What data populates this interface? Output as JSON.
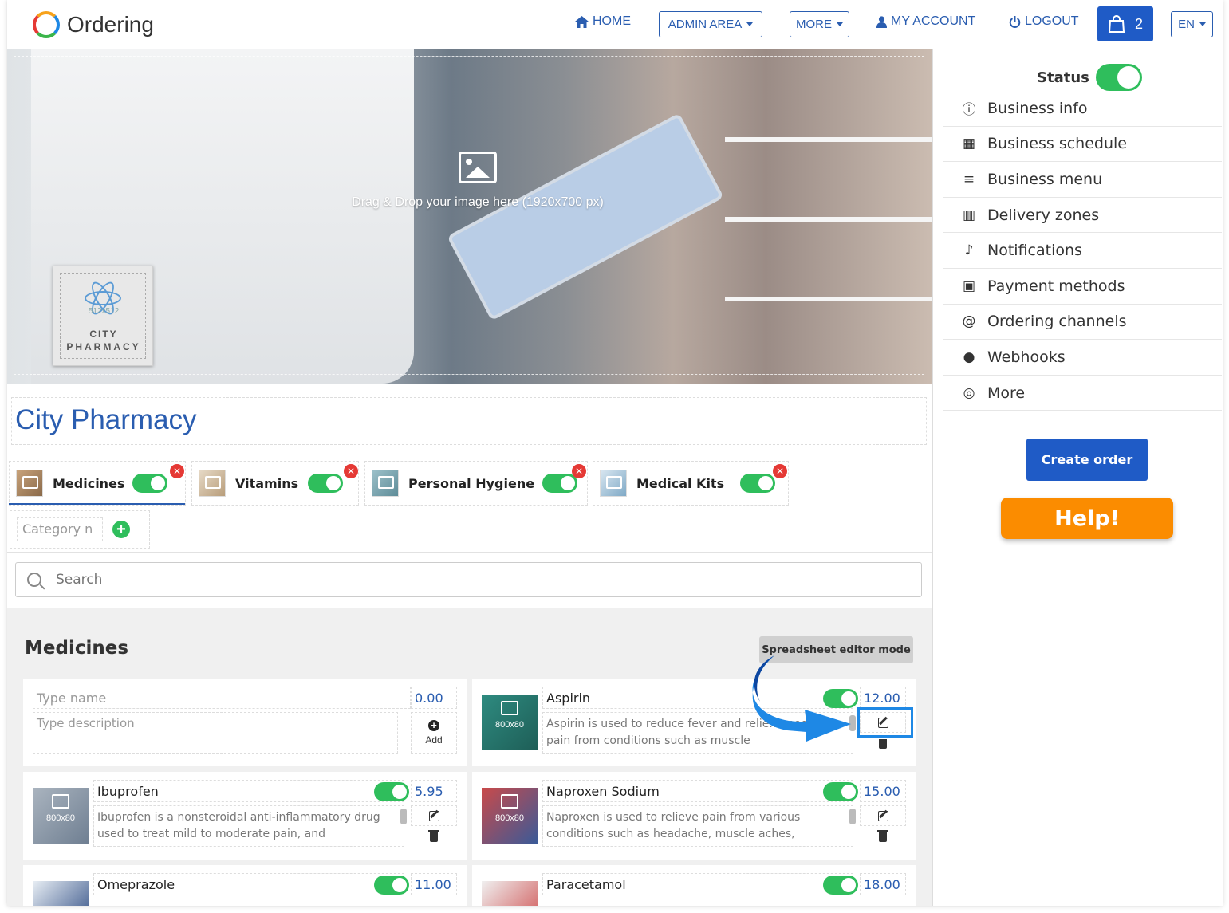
{
  "app": {
    "name": "Ordering"
  },
  "nav": {
    "home": "HOME",
    "admin_area": "ADMIN AREA",
    "more": "MORE",
    "my_account": "MY ACCOUNT",
    "logout": "LOGOUT",
    "cart_count": "2",
    "language": "EN"
  },
  "banner": {
    "drop_text": "Drag & Drop your image here (1920x700 px)",
    "logo_size": "512x512",
    "logo_line1": "CITY",
    "logo_line2": "PHARMACY"
  },
  "business": {
    "name": "City Pharmacy"
  },
  "categories": [
    {
      "name": "Medicines",
      "enabled": true,
      "active": true
    },
    {
      "name": "Vitamins",
      "enabled": true
    },
    {
      "name": "Personal Hygiene",
      "enabled": true
    },
    {
      "name": "Medical Kits",
      "enabled": true
    }
  ],
  "new_category": {
    "placeholder": "Category n"
  },
  "search": {
    "placeholder": "Search"
  },
  "section": {
    "title": "Medicines",
    "spreadsheet_button": "Spreadsheet editor mode"
  },
  "new_product": {
    "name_placeholder": "Type name",
    "description_placeholder": "Type description",
    "price": "0.00",
    "add_label": "Add"
  },
  "products": [
    {
      "name": "Aspirin",
      "price": "12.00",
      "description": "Aspirin is used to reduce fever and relie... moderate pain from conditions such as muscle",
      "image_size": "800x80",
      "enabled": true
    },
    {
      "name": "Ibuprofen",
      "price": "5.95",
      "description": "Ibuprofen is a nonsteroidal anti-inflammatory drug used to treat mild to moderate pain, and",
      "image_size": "800x80",
      "enabled": true
    },
    {
      "name": "Naproxen Sodium",
      "price": "15.00",
      "description": "Naproxen is used to relieve pain from various conditions such as headache, muscle aches,",
      "image_size": "800x80",
      "enabled": true
    },
    {
      "name": "Omeprazole",
      "price": "11.00",
      "description": "",
      "enabled": true
    },
    {
      "name": "Paracetamol",
      "price": "18.00",
      "description": "",
      "enabled": true
    }
  ],
  "sidebar": {
    "status_label": "Status",
    "status_enabled": true,
    "items": [
      {
        "label": "Business info",
        "icon": "info-icon"
      },
      {
        "label": "Business schedule",
        "icon": "calendar-icon"
      },
      {
        "label": "Business menu",
        "icon": "menu-icon"
      },
      {
        "label": "Delivery zones",
        "icon": "map-icon"
      },
      {
        "label": "Notifications",
        "icon": "bell-icon"
      },
      {
        "label": "Payment methods",
        "icon": "money-icon"
      },
      {
        "label": "Ordering channels",
        "icon": "at-icon"
      },
      {
        "label": "Webhooks",
        "icon": "globe-icon"
      },
      {
        "label": "More",
        "icon": "target-icon"
      }
    ],
    "create_order": "Create order",
    "help": "Help!"
  },
  "colors": {
    "primary": "#1f5bc6",
    "link": "#2a5db0",
    "toggle_on": "#2fbe5c",
    "help": "#fb8c00",
    "delete": "#e53935",
    "annotation": "#1e88e5"
  }
}
